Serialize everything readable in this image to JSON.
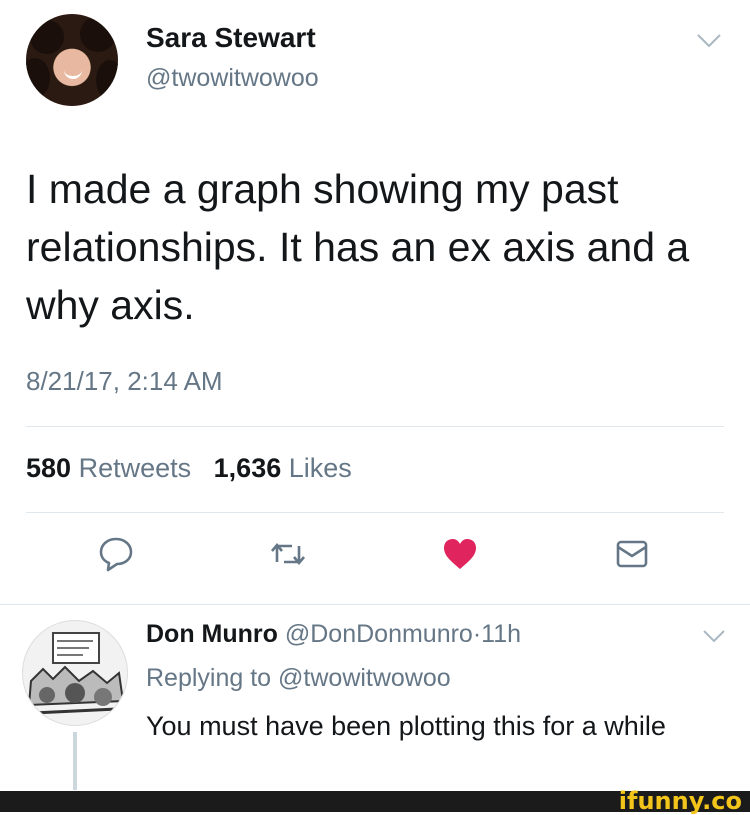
{
  "tweet": {
    "author_name": "Sara Stewart",
    "author_handle": "@twowitwowoo",
    "text": "I made a graph showing my past relationships. It has an ex axis and a why axis.",
    "timestamp": "8/21/17, 2:14 AM",
    "retweet_count": "580",
    "retweet_label": "Retweets",
    "like_count": "1,636",
    "like_label": "Likes"
  },
  "reply": {
    "author_name": "Don Munro",
    "author_handle": "@DonDonmunro",
    "separator": "·",
    "age": "11h",
    "replying_prefix": "Replying to",
    "replying_handle": "@twowitwowoo",
    "text": "You must have been plotting this for a while"
  },
  "icons": {
    "reply": "speech-bubble-icon",
    "retweet": "retweet-arrows-icon",
    "like": "heart-icon",
    "dm": "envelope-icon",
    "menu": "chevron-down-icon"
  },
  "colors": {
    "like_active": "#e0245e",
    "secondary_text": "#657786",
    "watermark": "#f3c41a"
  },
  "watermark": "ifunny.co"
}
